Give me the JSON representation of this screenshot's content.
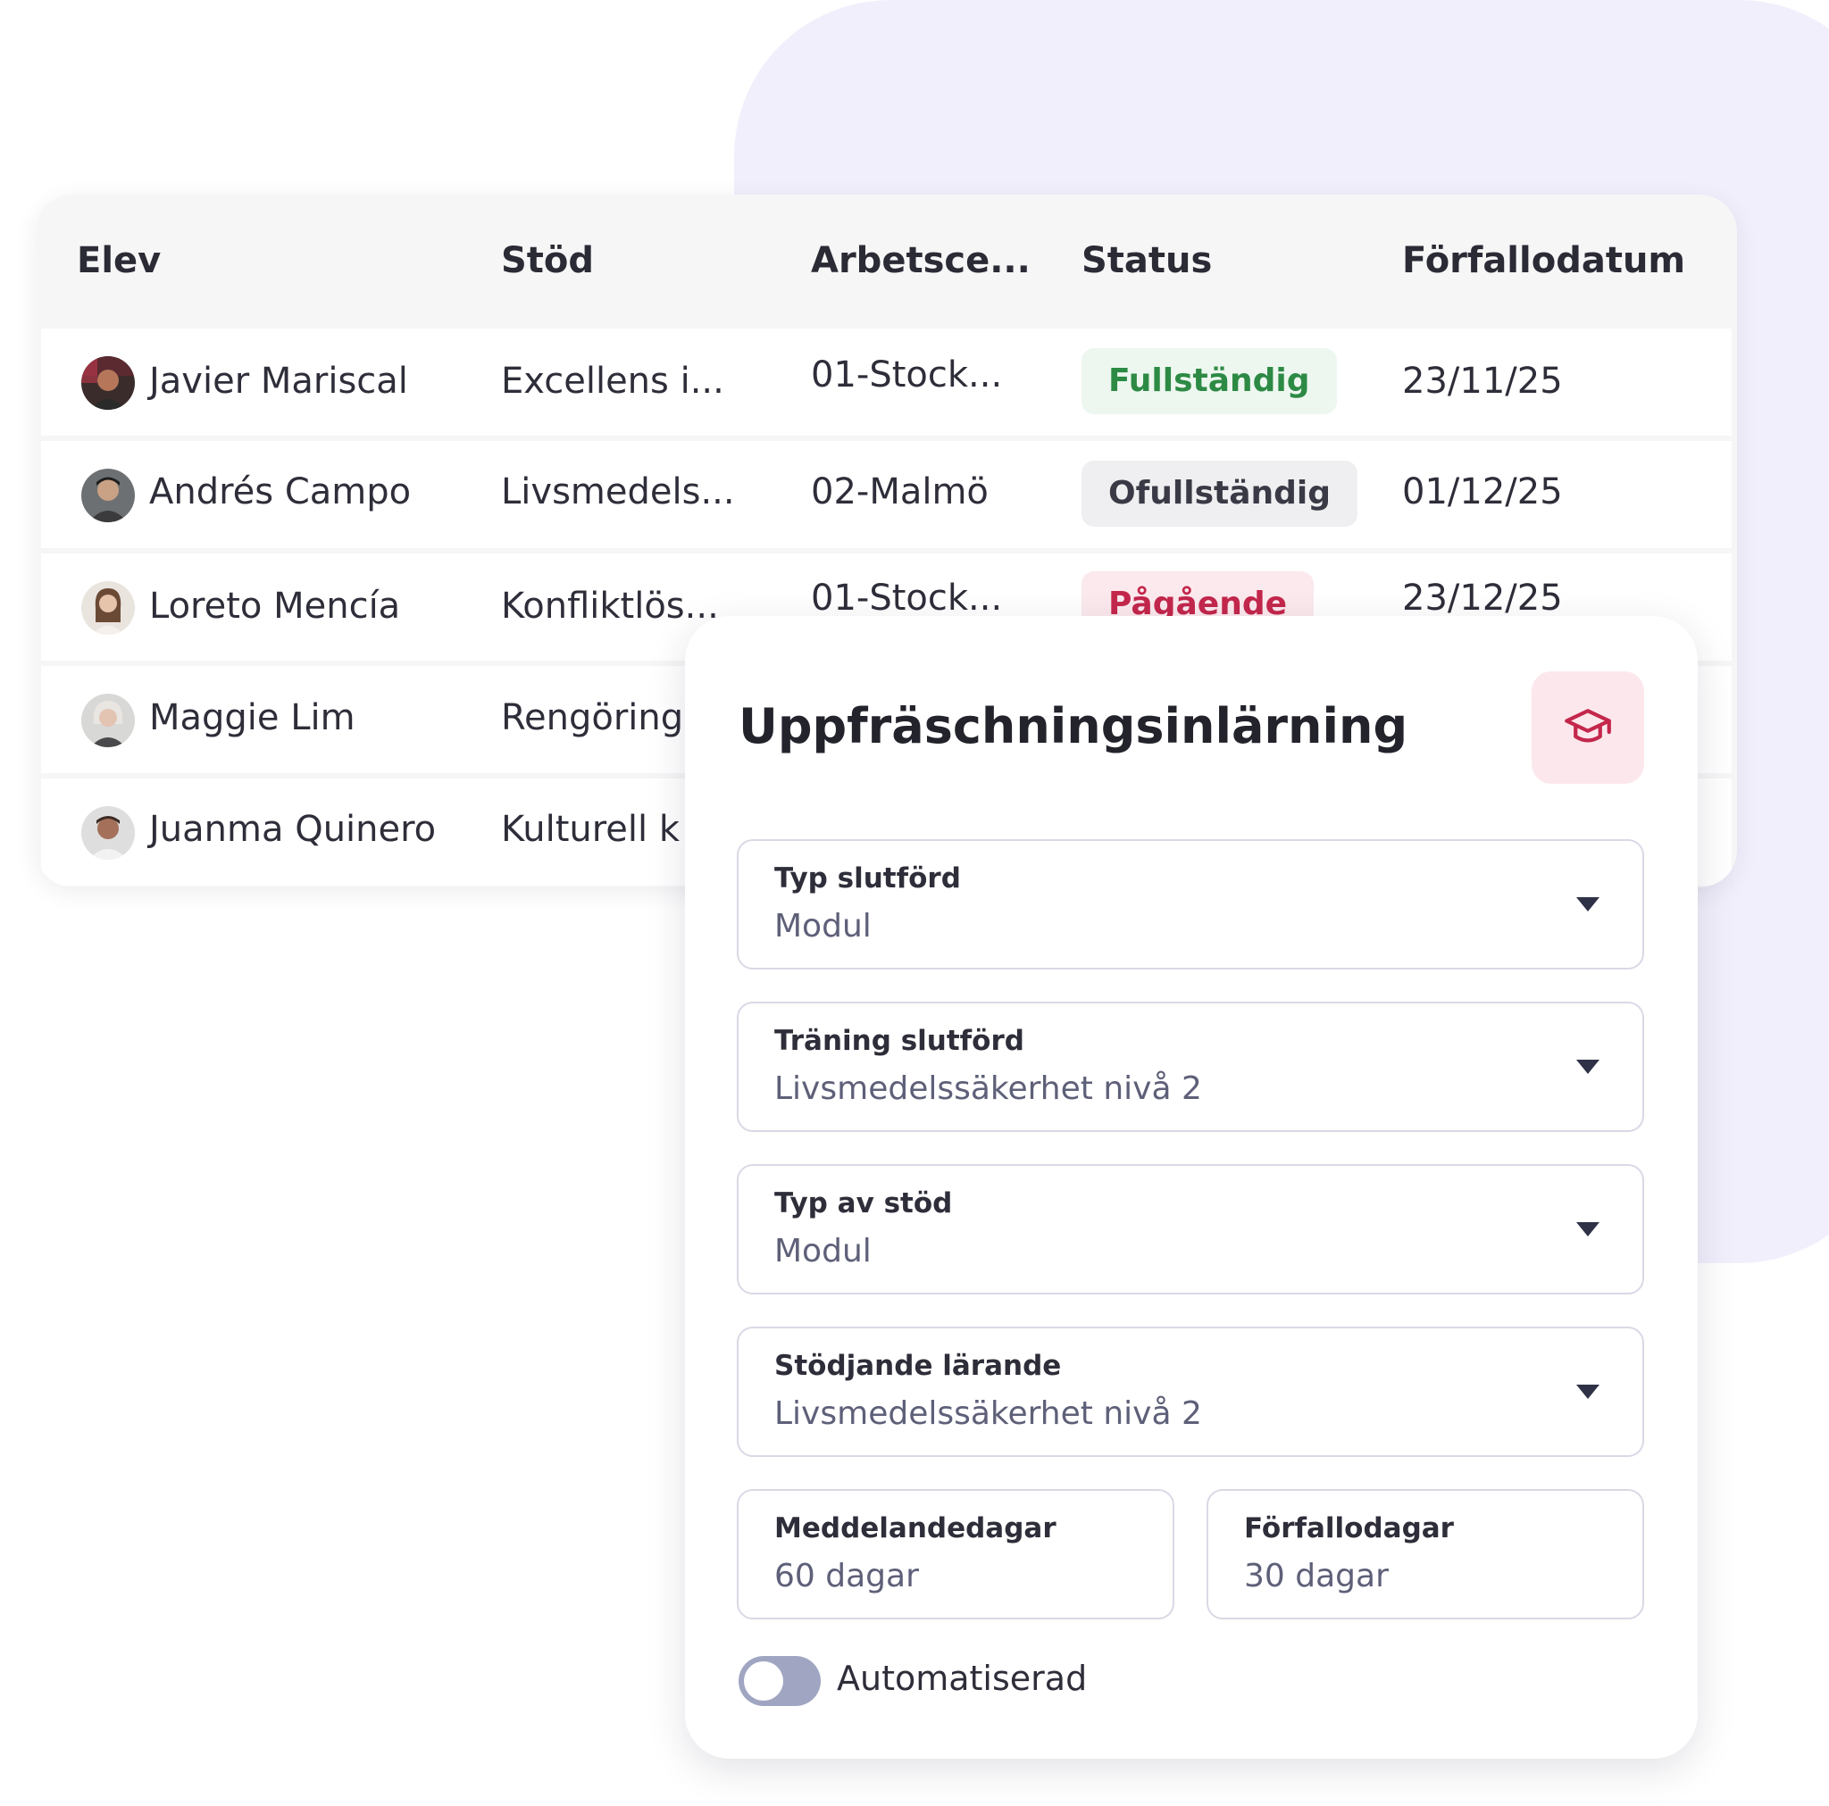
{
  "table": {
    "headers": {
      "student": "Elev",
      "support": "Stöd",
      "workplace": "Arbetsce...",
      "status": "Status",
      "due_date": "Förfallodatum"
    },
    "rows": [
      {
        "name": "Javier Mariscal",
        "support": "Excellens i...",
        "workplace": "01-Stock...",
        "status": "Fullständig",
        "status_color": "#2d8a45",
        "due": "23/11/25"
      },
      {
        "name": "Andrés Campo",
        "support": "Livsmedels...",
        "workplace": "02-Malmö",
        "status": "Ofullständig",
        "status_color": "#3a3a46",
        "due": "01/12/25"
      },
      {
        "name": "Loreto Mencía",
        "support": "Konfliktlös...",
        "workplace": "01-Stock...",
        "status": "Pågående",
        "status_color": "#c4274c",
        "due": "23/12/25"
      },
      {
        "name": "Maggie Lim",
        "support": "Rengöring"
      },
      {
        "name": "Juanma Quinero",
        "support": "Kulturell k"
      }
    ]
  },
  "modal": {
    "title": "Uppfräschningsinlärning",
    "icon": "graduation-cap-icon",
    "fields": [
      {
        "label": "Typ slutförd",
        "value": "Modul"
      },
      {
        "label": "Träning slutförd",
        "value": "Livsmedelssäkerhet nivå 2"
      },
      {
        "label": "Typ av stöd",
        "value": "Modul"
      },
      {
        "label": "Stödjande lärande",
        "value": "Livsmedelssäkerhet nivå 2"
      }
    ],
    "notice_days": {
      "label": "Meddelandedagar",
      "value": "60 dagar"
    },
    "due_days": {
      "label": "Förfallodagar",
      "value": "30 dagar"
    },
    "automated": {
      "label": "Automatiserad",
      "enabled": false
    }
  },
  "colors": {
    "background_blob": "#f2effc",
    "accent_pink": "#c4274c",
    "toggle_off": "#a0a6c2"
  }
}
